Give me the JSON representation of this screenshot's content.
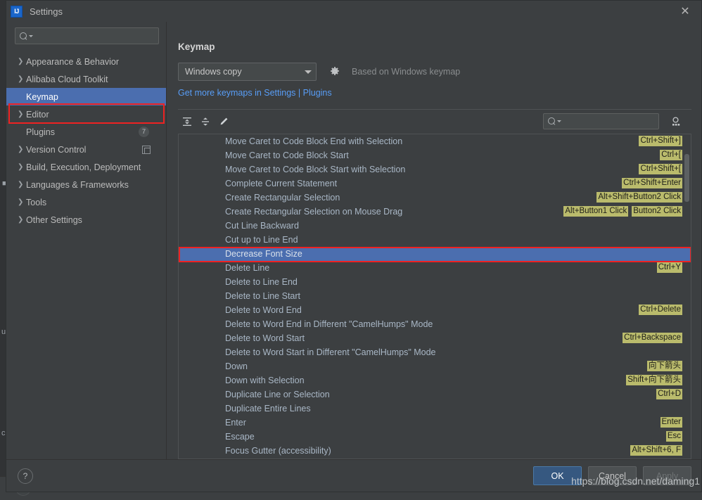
{
  "window": {
    "app_icon_text": "IJ",
    "title": "Settings",
    "close_label": "✕"
  },
  "sidebar": {
    "search_placeholder": "",
    "items": [
      {
        "label": "Appearance & Behavior",
        "expandable": true,
        "selected": false,
        "badge": null
      },
      {
        "label": "Alibaba Cloud Toolkit",
        "expandable": true,
        "selected": false,
        "badge": null
      },
      {
        "label": "Keymap",
        "expandable": false,
        "selected": true,
        "badge": null
      },
      {
        "label": "Editor",
        "expandable": true,
        "selected": false,
        "badge": null
      },
      {
        "label": "Plugins",
        "expandable": false,
        "selected": false,
        "badge": "7"
      },
      {
        "label": "Version Control",
        "expandable": true,
        "selected": false,
        "badge": null,
        "icon": "copy-icon"
      },
      {
        "label": "Build, Execution, Deployment",
        "expandable": true,
        "selected": false,
        "badge": null
      },
      {
        "label": "Languages & Frameworks",
        "expandable": true,
        "selected": false,
        "badge": null
      },
      {
        "label": "Tools",
        "expandable": true,
        "selected": false,
        "badge": null
      },
      {
        "label": "Other Settings",
        "expandable": true,
        "selected": false,
        "badge": null
      }
    ]
  },
  "keymap_page": {
    "title": "Keymap",
    "scheme_selected": "Windows copy",
    "based_on": "Based on Windows keymap",
    "more_keymaps_link": "Get more keymaps in Settings | Plugins",
    "toolbar": {
      "expand_all": "expand-all-icon",
      "collapse_all": "collapse-all-icon",
      "edit": "edit-pencil-icon",
      "search_placeholder": "",
      "find_by_shortcut": "find-by-shortcut-icon"
    },
    "actions": [
      {
        "name": "Move Caret to Code Block End with Selection",
        "shortcuts": [
          "Ctrl+Shift+]"
        ],
        "selected": false
      },
      {
        "name": "Move Caret to Code Block Start",
        "shortcuts": [
          "Ctrl+["
        ],
        "selected": false
      },
      {
        "name": "Move Caret to Code Block Start with Selection",
        "shortcuts": [
          "Ctrl+Shift+["
        ],
        "selected": false
      },
      {
        "name": "Complete Current Statement",
        "shortcuts": [
          "Ctrl+Shift+Enter"
        ],
        "selected": false
      },
      {
        "name": "Create Rectangular Selection",
        "shortcuts": [
          "Alt+Shift+Button2 Click"
        ],
        "selected": false
      },
      {
        "name": "Create Rectangular Selection on Mouse Drag",
        "shortcuts": [
          "Alt+Button1 Click",
          "Button2 Click"
        ],
        "selected": false
      },
      {
        "name": "Cut Line Backward",
        "shortcuts": [],
        "selected": false
      },
      {
        "name": "Cut up to Line End",
        "shortcuts": [],
        "selected": false
      },
      {
        "name": "Decrease Font Size",
        "shortcuts": [],
        "selected": true
      },
      {
        "name": "Delete Line",
        "shortcuts": [
          "Ctrl+Y"
        ],
        "selected": false
      },
      {
        "name": "Delete to Line End",
        "shortcuts": [],
        "selected": false
      },
      {
        "name": "Delete to Line Start",
        "shortcuts": [],
        "selected": false
      },
      {
        "name": "Delete to Word End",
        "shortcuts": [
          "Ctrl+Delete"
        ],
        "selected": false
      },
      {
        "name": "Delete to Word End in Different \"CamelHumps\" Mode",
        "shortcuts": [],
        "selected": false
      },
      {
        "name": "Delete to Word Start",
        "shortcuts": [
          "Ctrl+Backspace"
        ],
        "selected": false
      },
      {
        "name": "Delete to Word Start in Different \"CamelHumps\" Mode",
        "shortcuts": [],
        "selected": false
      },
      {
        "name": "Down",
        "shortcuts": [
          "向下箭头"
        ],
        "selected": false
      },
      {
        "name": "Down with Selection",
        "shortcuts": [
          "Shift+向下箭头"
        ],
        "selected": false
      },
      {
        "name": "Duplicate Line or Selection",
        "shortcuts": [
          "Ctrl+D"
        ],
        "selected": false
      },
      {
        "name": "Duplicate Entire Lines",
        "shortcuts": [],
        "selected": false
      },
      {
        "name": "Enter",
        "shortcuts": [
          "Enter"
        ],
        "selected": false
      },
      {
        "name": "Escape",
        "shortcuts": [
          "Esc"
        ],
        "selected": false
      },
      {
        "name": "Focus Gutter (accessibility)",
        "shortcuts": [
          "Alt+Shift+6, F"
        ],
        "selected": false
      }
    ]
  },
  "footer": {
    "help_label": "?",
    "ok_label": "OK",
    "cancel_label": "Cancel",
    "apply_label": "Apply"
  },
  "watermark": "https://blog.csdn.net/daming1",
  "colors": {
    "selection_blue": "#4b6eaf",
    "annotation_red": "#ee2222",
    "shortcut_badge": "#babb6c",
    "link_blue": "#589df6",
    "primary_button": "#365880"
  }
}
